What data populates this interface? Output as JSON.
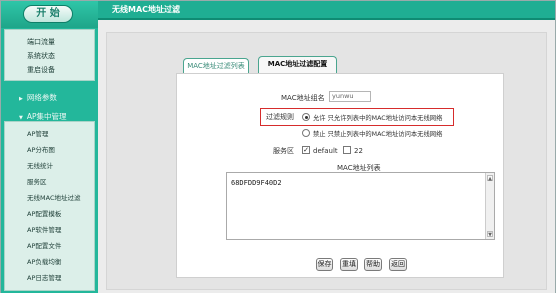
{
  "header": {
    "title": "无线MAC地址过滤"
  },
  "sidebar": {
    "start_label": "开 始",
    "group_items": [
      "端口流量",
      "系统状态",
      "重启设备"
    ],
    "sections": [
      "网络参数",
      "AP集中管理"
    ],
    "sub_items": [
      "AP管理",
      "AP分布图",
      "无线统计",
      "服务区",
      "无线MAC地址过滤",
      "AP配置模板",
      "AP软件管理",
      "AP配置文件",
      "AP负载均衡",
      "AP日志管理"
    ]
  },
  "tabs": {
    "list": "MAC地址过滤列表",
    "config": "MAC地址过滤配置"
  },
  "form": {
    "group_name_label": "MAC地址组名",
    "group_name_value": "yunwu",
    "rule_label": "过滤规则",
    "rule_allow_text": "允许 只允许列表中的MAC地址访问本无线网络",
    "rule_deny_text": "禁止 只禁止列表中的MAC地址访问本无线网络",
    "service_zone_label": "服务区",
    "zone_default": "default",
    "zone_22": "22",
    "mac_list_label": "MAC地址列表",
    "mac_list_value": "68DFDD9F40D2"
  },
  "buttons": {
    "save": "保存",
    "reset": "重填",
    "help": "帮助",
    "back": "返回"
  }
}
